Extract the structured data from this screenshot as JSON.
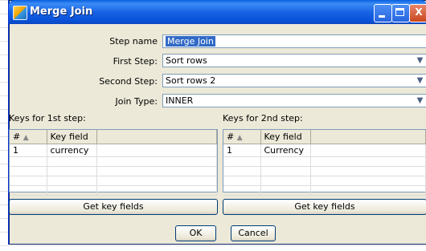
{
  "window": {
    "title": "Merge Join",
    "minimize": "",
    "maximize": "",
    "close": "X"
  },
  "form": {
    "step_name_label": "Step name",
    "step_name_value": "Merge Join",
    "first_step_label": "First Step:",
    "first_step_value": "Sort rows",
    "second_step_label": "Second Step:",
    "second_step_value": "Sort rows 2",
    "join_type_label": "Join Type:",
    "join_type_value": "INNER"
  },
  "keys1": {
    "label": "Keys for 1st step:",
    "columns": [
      "#",
      "Key field"
    ],
    "rows": [
      [
        "1",
        "currency"
      ]
    ],
    "button": "Get key fields"
  },
  "keys2": {
    "label": "Keys for 2nd step:",
    "columns": [
      "#",
      "Key field"
    ],
    "rows": [
      [
        "1",
        "Currency"
      ]
    ],
    "button": "Get key fields"
  },
  "buttons": {
    "ok": "OK",
    "cancel": "Cancel"
  },
  "colors": {
    "title_bar": "#0a5fe0",
    "dialog_bg": "#ece9d8",
    "selection": "#316ac5"
  }
}
